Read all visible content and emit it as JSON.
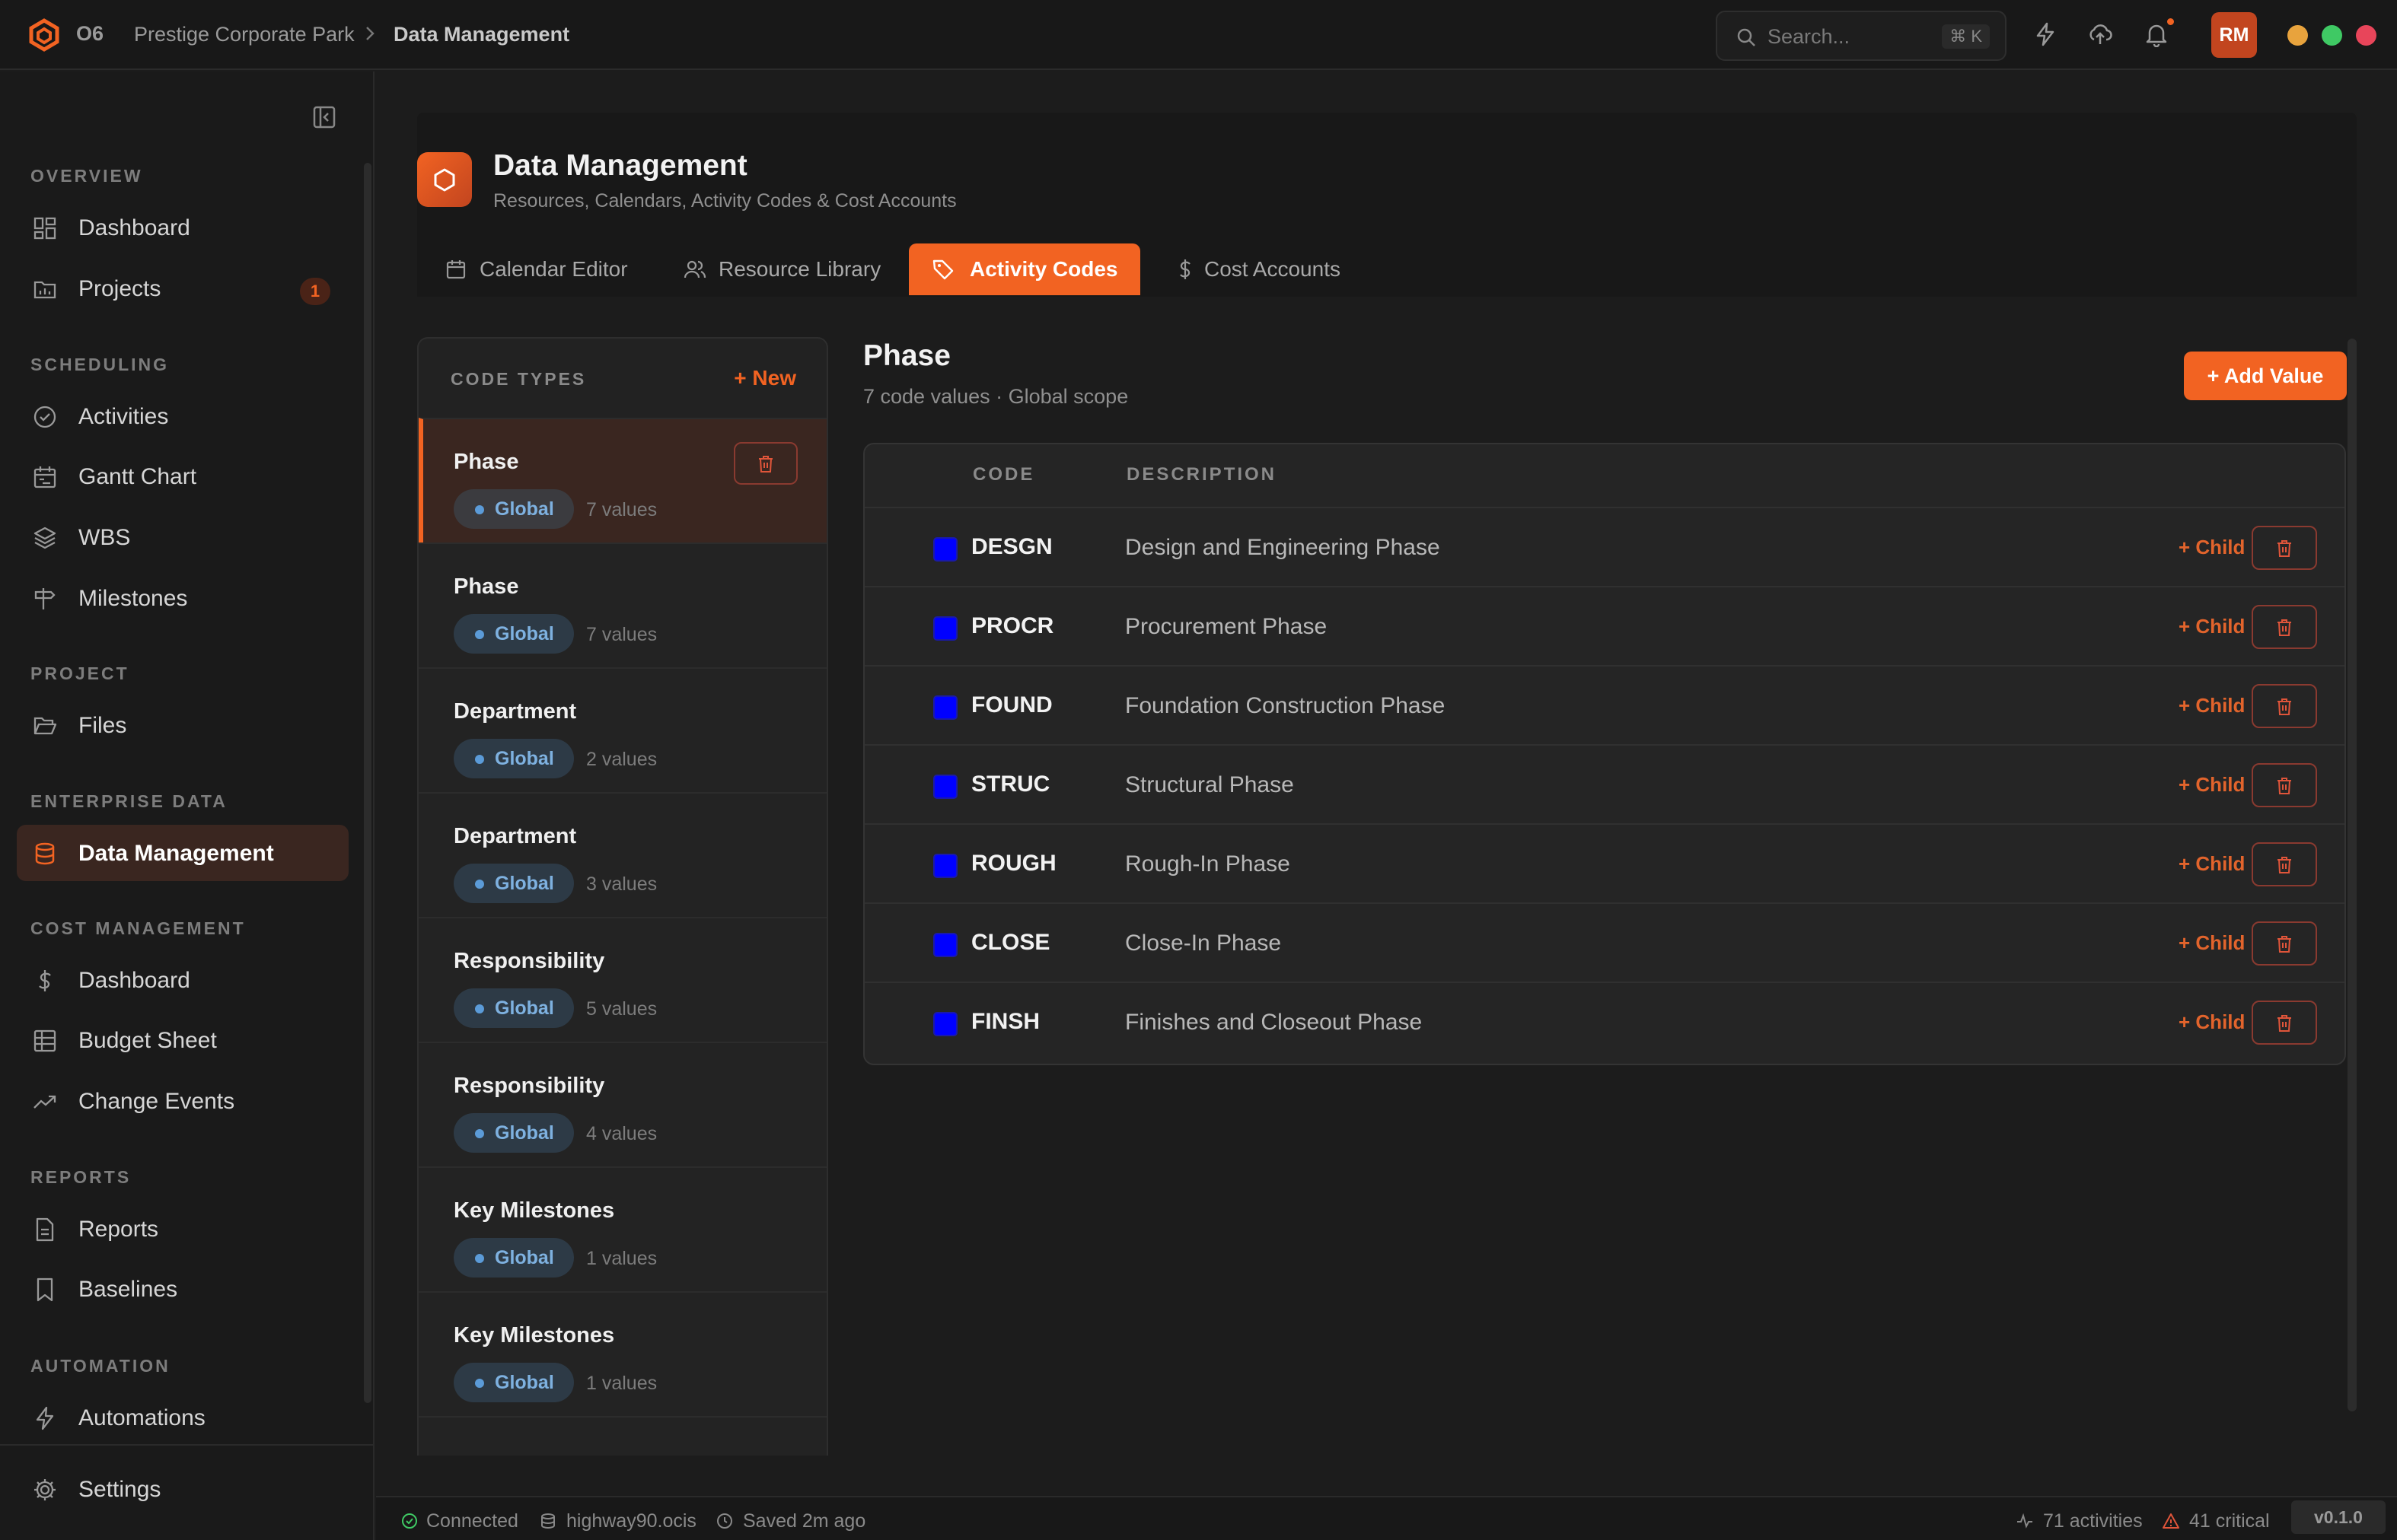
{
  "app": {
    "name": "O6"
  },
  "breadcrumb": {
    "project": "Prestige Corporate Park",
    "current": "Data Management"
  },
  "search": {
    "placeholder": "Search...",
    "shortcut": "⌘ K"
  },
  "user": {
    "initials": "RM"
  },
  "colors": {
    "accent": "#f26322",
    "window_dots": [
      "#e8a33d",
      "#3fc964",
      "#e8455a"
    ],
    "code_swatch": "#0000ff"
  },
  "sidebar": {
    "sections": {
      "overview": "OVERVIEW",
      "scheduling": "SCHEDULING",
      "project": "PROJECT",
      "enterprise": "ENTERPRISE DATA",
      "cost": "COST MANAGEMENT",
      "reports": "REPORTS",
      "automation": "AUTOMATION"
    },
    "items": {
      "dashboard": "Dashboard",
      "projects": "Projects",
      "projects_badge": "1",
      "activities": "Activities",
      "gantt": "Gantt Chart",
      "wbs": "WBS",
      "milestones": "Milestones",
      "files": "Files",
      "data_management": "Data Management",
      "cost_dashboard": "Dashboard",
      "budget_sheet": "Budget Sheet",
      "change_events": "Change Events",
      "reports": "Reports",
      "baselines": "Baselines",
      "automations": "Automations",
      "settings": "Settings"
    }
  },
  "header": {
    "title": "Data Management",
    "subtitle": "Resources, Calendars, Activity Codes & Cost Accounts",
    "tabs": [
      "Calendar Editor",
      "Resource Library",
      "Activity Codes",
      "Cost Accounts"
    ]
  },
  "code_types": {
    "heading": "CODE TYPES",
    "new_label": "+ New",
    "items": [
      {
        "name": "Phase",
        "scope": "Global",
        "count": "7 values"
      },
      {
        "name": "Phase",
        "scope": "Global",
        "count": "7 values"
      },
      {
        "name": "Department",
        "scope": "Global",
        "count": "2 values"
      },
      {
        "name": "Department",
        "scope": "Global",
        "count": "3 values"
      },
      {
        "name": "Responsibility",
        "scope": "Global",
        "count": "5 values"
      },
      {
        "name": "Responsibility",
        "scope": "Global",
        "count": "4 values"
      },
      {
        "name": "Key Milestones",
        "scope": "Global",
        "count": "1 values"
      },
      {
        "name": "Key Milestones",
        "scope": "Global",
        "count": "1 values"
      }
    ]
  },
  "detail": {
    "title": "Phase",
    "subtitle": "7 code values · Global scope",
    "add_label": "+ Add Value",
    "columns": {
      "code": "CODE",
      "description": "DESCRIPTION"
    },
    "child_label": "+ Child",
    "rows": [
      {
        "code": "DESGN",
        "description": "Design and Engineering Phase"
      },
      {
        "code": "PROCR",
        "description": "Procurement Phase"
      },
      {
        "code": "FOUND",
        "description": "Foundation Construction Phase"
      },
      {
        "code": "STRUC",
        "description": "Structural Phase"
      },
      {
        "code": "ROUGH",
        "description": "Rough-In Phase"
      },
      {
        "code": "CLOSE",
        "description": "Close-In Phase"
      },
      {
        "code": "FINSH",
        "description": "Finishes and Closeout Phase"
      }
    ]
  },
  "status": {
    "connection": "Connected",
    "file": "highway90.ocis",
    "saved": "Saved 2m ago",
    "activities": "71 activities",
    "critical": "41 critical",
    "version": "v0.1.0"
  }
}
